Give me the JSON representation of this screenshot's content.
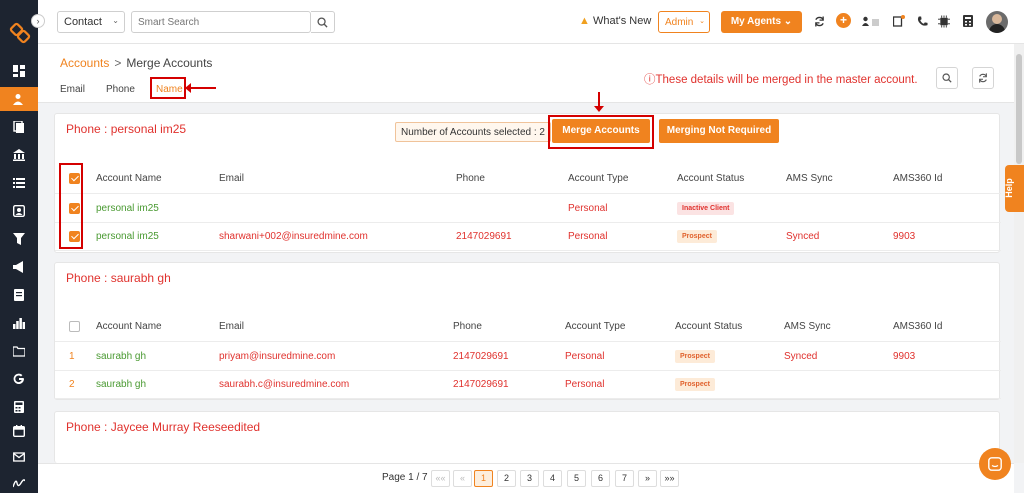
{
  "topbar": {
    "contact_select": "Contact",
    "search_placeholder": "Smart Search",
    "whats_new": "What's New",
    "admin_select": "Admin",
    "my_agents": "My Agents"
  },
  "header": {
    "breadcrumb_root": "Accounts",
    "breadcrumb_sep": ">",
    "breadcrumb_current": "Merge Accounts",
    "tabs": [
      {
        "label": "Email"
      },
      {
        "label": "Phone"
      },
      {
        "label": "Name"
      }
    ],
    "info_message": "These details will be merged in the master account."
  },
  "columns": [
    "Account Name",
    "Email",
    "Phone",
    "Account Type",
    "Account Status",
    "AMS Sync",
    "AMS360 Id"
  ],
  "groups": [
    {
      "title": "Phone : personal im25",
      "selected_label": "Number of Accounts selected : 2",
      "merge_label": "Merge Accounts",
      "not_required_label": "Merging Not Required",
      "rows": [
        {
          "name": "personal im25",
          "email": "",
          "phone": "",
          "type": "Personal",
          "status": "Inactive Client",
          "ams_sync": "",
          "ams_id": ""
        },
        {
          "name": "personal im25",
          "email": "sharwani+002@insuredmine.com",
          "phone": "2147029691",
          "type": "Personal",
          "status": "Prospect",
          "ams_sync": "Synced",
          "ams_id": "9903"
        }
      ]
    },
    {
      "title": "Phone : saurabh gh",
      "rows": [
        {
          "index": "1",
          "name": "saurabh gh",
          "email": "priyam@insuredmine.com",
          "phone": "2147029691",
          "type": "Personal",
          "status": "Prospect",
          "ams_sync": "Synced",
          "ams_id": "9903"
        },
        {
          "index": "2",
          "name": "saurabh gh",
          "email": "saurabh.c@insuredmine.com",
          "phone": "2147029691",
          "type": "Personal",
          "status": "Prospect",
          "ams_sync": "",
          "ams_id": ""
        }
      ]
    },
    {
      "title": "Phone : Jaycee Murray Reeseedited"
    }
  ],
  "pagination": {
    "info": "Page 1 / 7",
    "first": "««",
    "prev": "«",
    "pages": [
      "1",
      "2",
      "3",
      "4",
      "5",
      "6",
      "7"
    ],
    "next": "»",
    "last": "»»"
  },
  "help_label": "Help",
  "colors": {
    "accent": "#f0831f",
    "danger": "#e0322e",
    "green": "#4a9a32",
    "sidebar": "#1d2430"
  }
}
